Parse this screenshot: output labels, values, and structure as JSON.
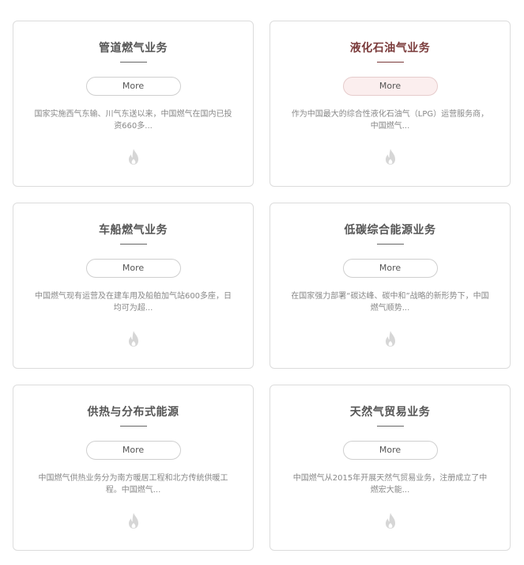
{
  "cards": [
    {
      "title": "管道燃气业务",
      "more_label": "More",
      "description": "国家实施西气东输、川气东送以来，中国燃气在国内已投资660多...",
      "icon": "flame-icon",
      "active": false
    },
    {
      "title": "液化石油气业务",
      "more_label": "More",
      "description": "作为中国最大的综合性液化石油气（LPG）运营服务商，中国燃气...",
      "icon": "flame-icon",
      "active": true
    },
    {
      "title": "车船燃气业务",
      "more_label": "More",
      "description": "中国燃气现有运营及在建车用及船舶加气站600多座，日均可为超...",
      "icon": "flame-icon",
      "active": false
    },
    {
      "title": "低碳综合能源业务",
      "more_label": "More",
      "description": "在国家强力部署“碳达峰、碳中和”战略的新形势下，中国燃气顺势...",
      "icon": "flame-icon",
      "active": false
    },
    {
      "title": "供热与分布式能源",
      "more_label": "More",
      "description": "中国燃气供热业务分为南方暖居工程和北方传统供暖工程。中国燃气...",
      "icon": "flame-icon",
      "active": false
    },
    {
      "title": "天然气贸易业务",
      "more_label": "More",
      "description": "中国燃气从2015年开展天然气贸易业务，注册成立了中燃宏大能...",
      "icon": "flame-icon",
      "active": false
    }
  ],
  "colors": {
    "border": "#dcdcdc",
    "title": "#555555",
    "title_active": "#7a3a3a",
    "button_active_bg": "#fbeeee",
    "description": "#888888",
    "icon": "#d6d6d6"
  }
}
